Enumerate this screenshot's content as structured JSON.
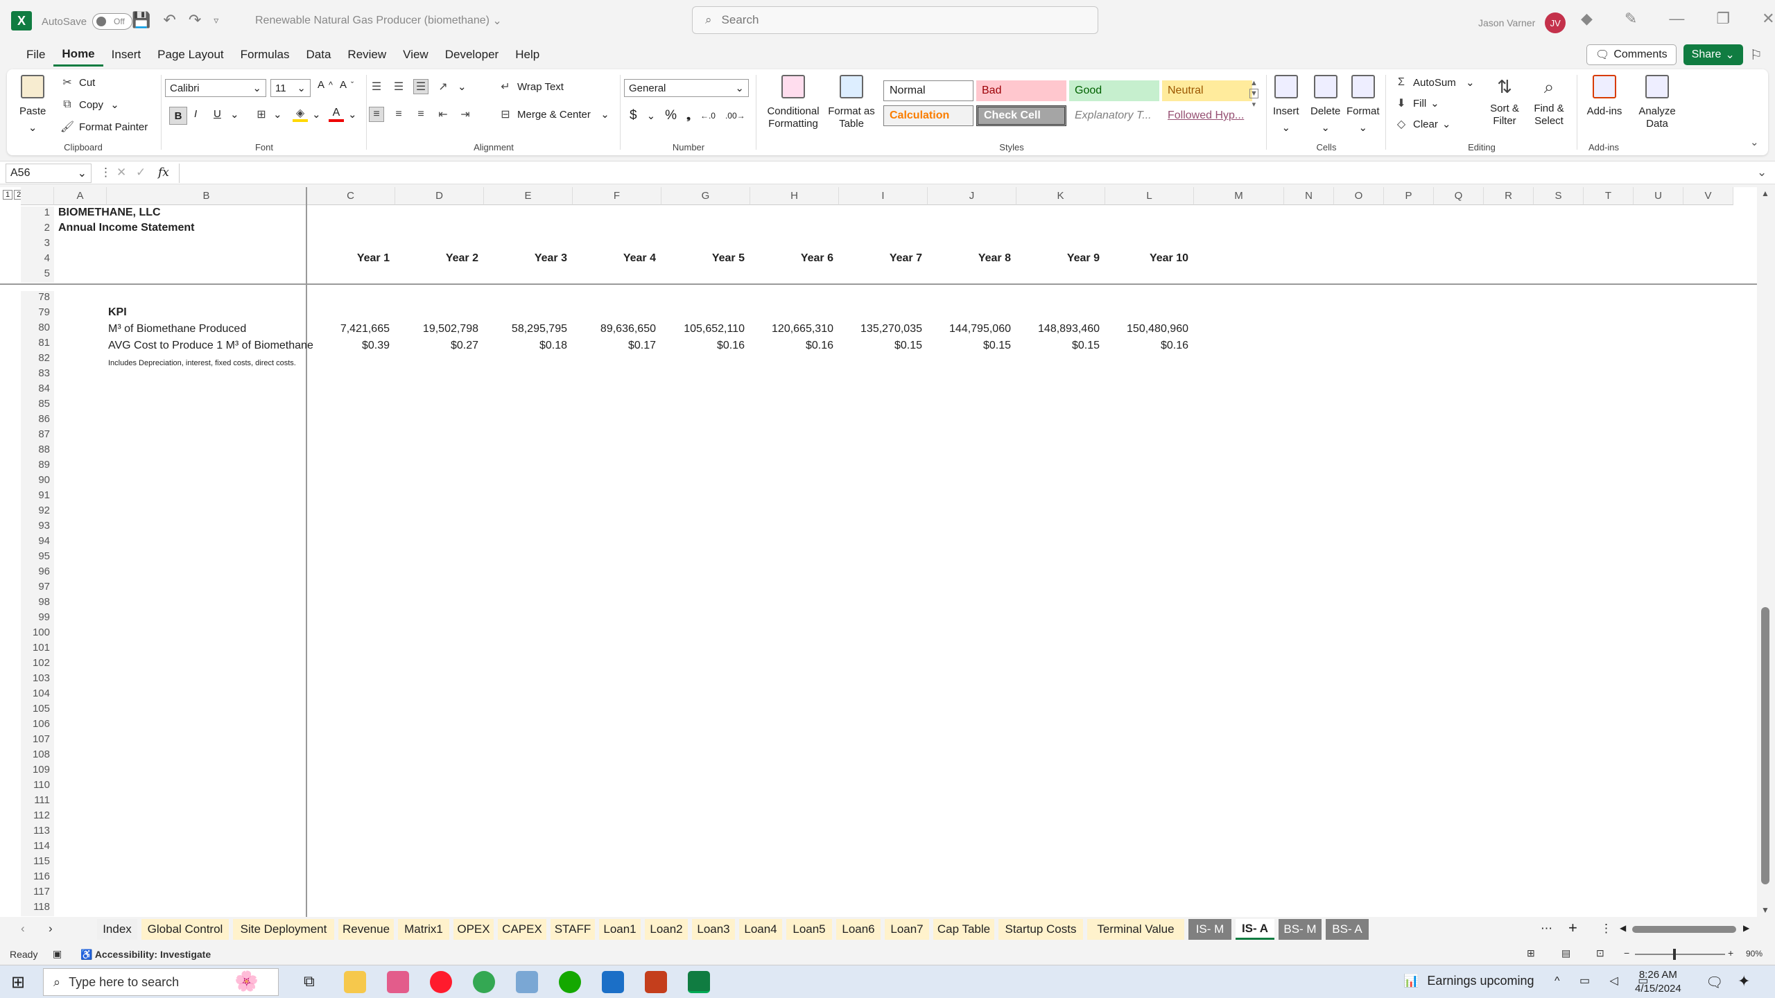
{
  "titlebar": {
    "autosave_label": "AutoSave",
    "autosave_state": "Off",
    "doc_title": "Renewable Natural Gas Producer (biomethane)",
    "search_placeholder": "Search",
    "user_name": "Jason Varner",
    "user_initials": "JV"
  },
  "menu": [
    "File",
    "Home",
    "Insert",
    "Page Layout",
    "Formulas",
    "Data",
    "Review",
    "View",
    "Developer",
    "Help"
  ],
  "menu_active": "Home",
  "actions": {
    "comments": "Comments",
    "share": "Share"
  },
  "ribbon": {
    "clipboard": {
      "label": "Clipboard",
      "paste": "Paste",
      "cut": "Cut",
      "copy": "Copy",
      "format_painter": "Format Painter"
    },
    "font": {
      "label": "Font",
      "name": "Calibri",
      "size": "11",
      "bold": "B",
      "italic": "I",
      "underline": "U"
    },
    "alignment": {
      "label": "Alignment",
      "wrap": "Wrap Text",
      "merge": "Merge & Center"
    },
    "number": {
      "label": "Number",
      "format": "General",
      "currency": "$",
      "percent": "%",
      "comma": "❟"
    },
    "styles": {
      "label": "Styles",
      "conditional": "Conditional Formatting",
      "format_table": "Format as Table",
      "cells": [
        "Normal",
        "Bad",
        "Good",
        "Neutral",
        "Calculation",
        "Check Cell",
        "Explanatory T...",
        "Followed Hyp..."
      ]
    },
    "cells": {
      "label": "Cells",
      "insert": "Insert",
      "delete": "Delete",
      "format": "Format"
    },
    "editing": {
      "label": "Editing",
      "autosum": "AutoSum",
      "fill": "Fill",
      "clear": "Clear",
      "sort": "Sort & Filter",
      "find": "Find & Select"
    },
    "addins": {
      "label": "Add-ins",
      "addins": "Add-ins",
      "analyze": "Analyze Data"
    }
  },
  "formula_bar": {
    "name_box": "A56",
    "fx": "fx",
    "value": ""
  },
  "columns": [
    "A",
    "B",
    "C",
    "D",
    "E",
    "F",
    "G",
    "H",
    "I",
    "J",
    "K",
    "L",
    "M",
    "N",
    "O",
    "P",
    "Q",
    "R",
    "S",
    "T",
    "U",
    "V"
  ],
  "frozen_rows": [
    "1",
    "2",
    "3",
    "4",
    "5"
  ],
  "scroll_rows": [
    "78",
    "79",
    "80",
    "81",
    "82",
    "83",
    "84",
    "85",
    "86",
    "87",
    "88",
    "89",
    "90",
    "91",
    "92",
    "93",
    "94",
    "95",
    "96",
    "97",
    "98",
    "99",
    "100",
    "101",
    "102",
    "103",
    "104",
    "105",
    "106",
    "107",
    "108",
    "109",
    "110",
    "111",
    "112",
    "113",
    "114",
    "115",
    "116",
    "117",
    "118"
  ],
  "sheet": {
    "company": "BIOMETHANE, LLC",
    "statement": "Annual Income Statement",
    "years": [
      "Year 1",
      "Year 2",
      "Year 3",
      "Year 4",
      "Year 5",
      "Year 6",
      "Year 7",
      "Year 8",
      "Year 9",
      "Year 10"
    ],
    "kpi_label": "KPI",
    "row80_label": "M³ of Biomethane Produced",
    "row80_values": [
      "7,421,665",
      "19,502,798",
      "58,295,795",
      "89,636,650",
      "105,652,110",
      "120,665,310",
      "135,270,035",
      "144,795,060",
      "148,893,460",
      "150,480,960"
    ],
    "row81_label": "AVG Cost to Produce 1 M³ of Biomethane",
    "row81_values": [
      "$0.39",
      "$0.27",
      "$0.18",
      "$0.17",
      "$0.16",
      "$0.16",
      "$0.15",
      "$0.15",
      "$0.15",
      "$0.16"
    ],
    "row82_note": "Includes Depreciation, interest, fixed costs, direct costs."
  },
  "tabs": [
    "Index",
    "Global Control",
    "Site Deployment",
    "Revenue",
    "Matrix1",
    "OPEX",
    "CAPEX",
    "STAFF",
    "Loan1",
    "Loan2",
    "Loan3",
    "Loan4",
    "Loan5",
    "Loan6",
    "Loan7",
    "Cap Table",
    "Startup Costs",
    "Terminal Value",
    "IS- M",
    "IS- A",
    "BS- M",
    "BS- A"
  ],
  "active_tab": "IS- A",
  "status": {
    "ready": "Ready",
    "accessibility": "Accessibility: Investigate",
    "zoom": "90%"
  },
  "taskbar": {
    "search_placeholder": "Type here to search",
    "news": "Earnings upcoming",
    "time": "8:26 AM",
    "date": "4/15/2024"
  },
  "colors": {
    "excel_green": "#107c41",
    "tab_yellow": "#fff2cc",
    "tab_gray": "#808080"
  }
}
